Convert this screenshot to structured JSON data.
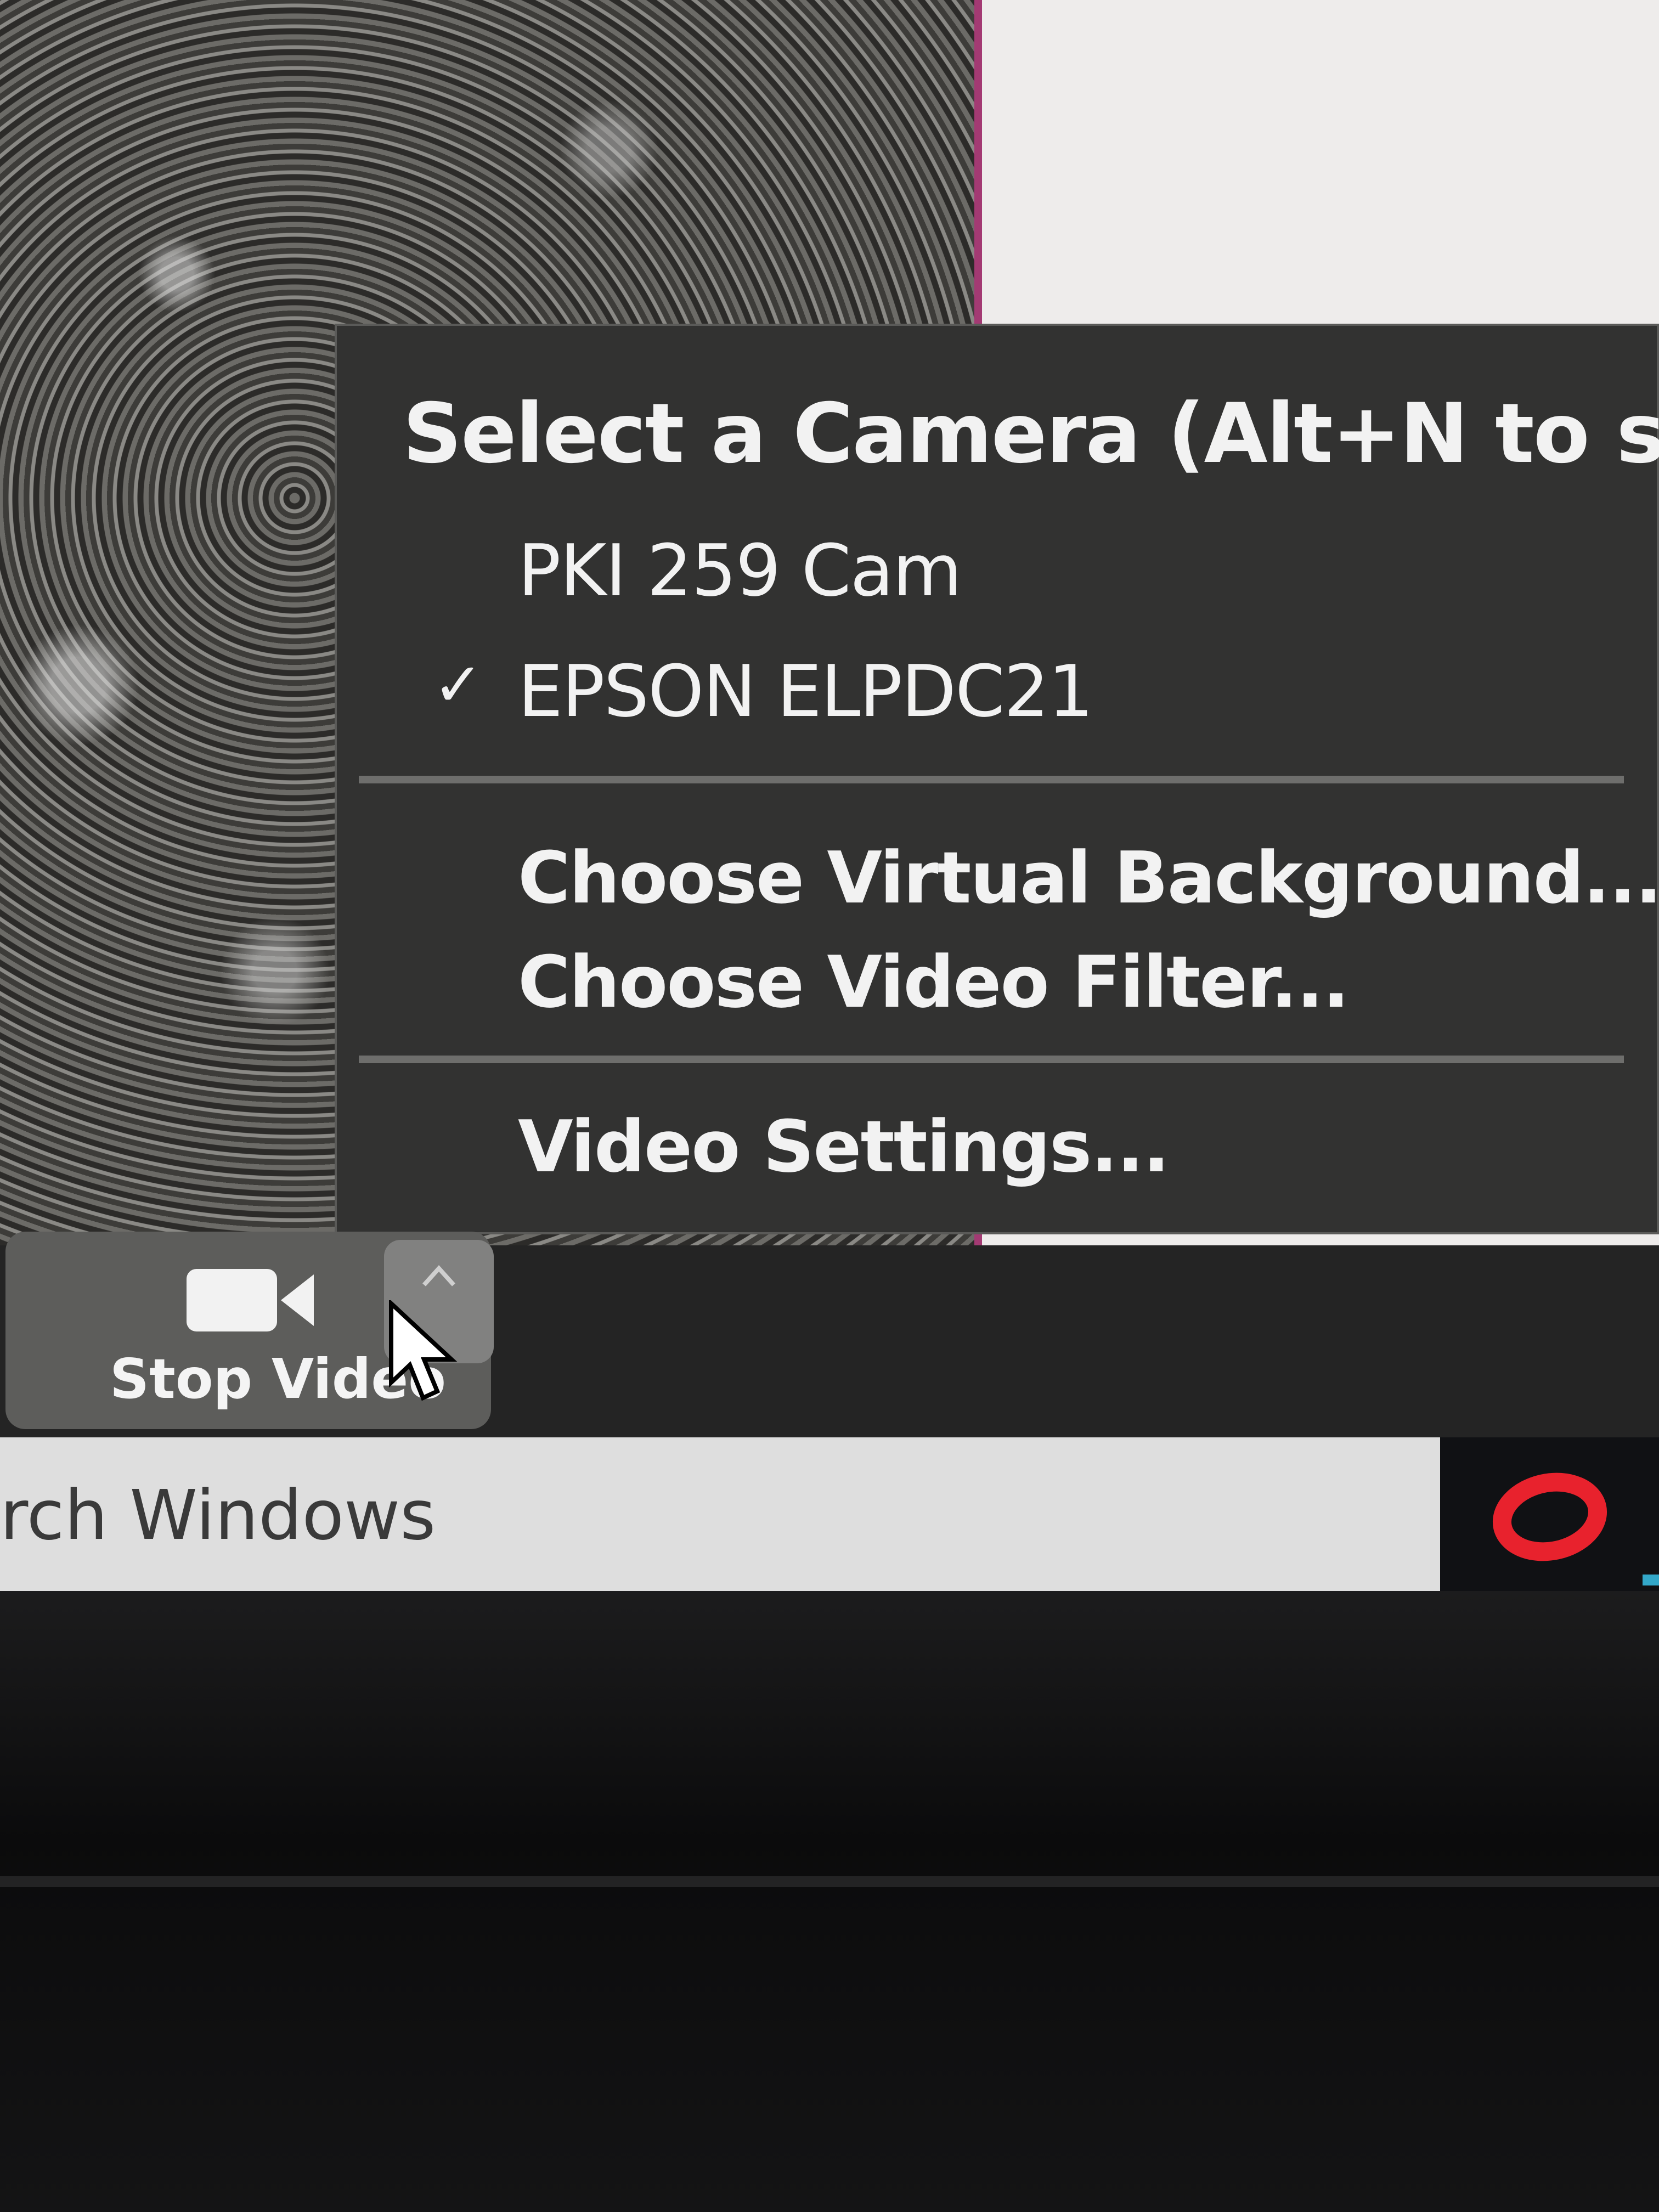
{
  "camera_menu": {
    "header": "Select a Camera (Alt+N to switch)",
    "cameras": [
      {
        "label": "PKI 259 Cam",
        "selected": false
      },
      {
        "label": "EPSON ELPDC21",
        "selected": true
      }
    ],
    "options": [
      "Choose Virtual Background...",
      "Choose Video Filter..."
    ],
    "settings": "Video Settings..."
  },
  "toolbar": {
    "stop_video_label": "Stop Video",
    "video_icon": "video-camera-icon",
    "caret_icon": "caret-up-icon"
  },
  "taskbar": {
    "search_text": "rch Windows",
    "app_icon": "opera-icon",
    "app_icon_color": "#e8222d"
  },
  "colors": {
    "menu_background": "#323231",
    "menu_text": "#f2f2f2",
    "button_background": "#5d5d5b"
  }
}
